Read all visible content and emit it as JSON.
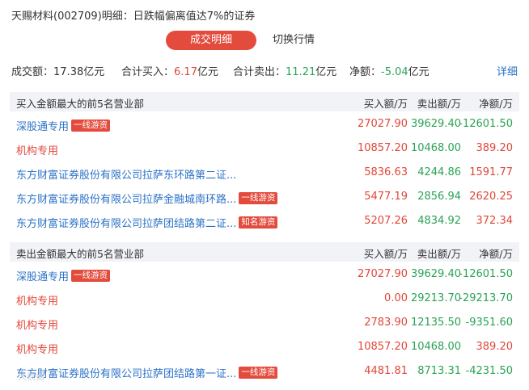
{
  "header": {
    "title": "天赐材料(002709)明细：日跌幅偏离值达7%的证券"
  },
  "tabs": {
    "active": "成交明细",
    "other": "切换行情"
  },
  "summary": {
    "turnover_label": "成交额：",
    "turnover_value": "17.38亿元",
    "buy_label": "合计买入：",
    "buy_value": "6.17",
    "buy_unit": "亿元",
    "sell_label": "合计卖出：",
    "sell_value": "11.21",
    "sell_unit": "亿元",
    "net_label": "净额：",
    "net_value": "-5.04",
    "net_unit": "亿元",
    "detail_link": "详细"
  },
  "columns": {
    "buy": "买入额/万",
    "sell": "卖出额/万",
    "net": "净额/万"
  },
  "buy_section": {
    "title": "买入金额最大的前5名营业部",
    "rows": [
      {
        "name": "深股通专用",
        "badge": "一线游资",
        "buy": "27027.90",
        "sell": "39629.40",
        "net": "-12601.50"
      },
      {
        "name": "机构专用",
        "badge": "",
        "buy": "10857.20",
        "sell": "10468.00",
        "net": "389.20"
      },
      {
        "name": "东方财富证券股份有限公司拉萨东环路第二证...",
        "badge": "",
        "buy": "5836.63",
        "sell": "4244.86",
        "net": "1591.77"
      },
      {
        "name": "东方财富证券股份有限公司拉萨金融城南环路...",
        "badge": "一线游资",
        "buy": "5477.19",
        "sell": "2856.94",
        "net": "2620.25"
      },
      {
        "name": "东方财富证券股份有限公司拉萨团结路第二证...",
        "badge": "知名游资",
        "buy": "5207.26",
        "sell": "4834.92",
        "net": "372.34"
      }
    ]
  },
  "sell_section": {
    "title": "卖出金额最大的前5名营业部",
    "rows": [
      {
        "name": "深股通专用",
        "badge": "一线游资",
        "buy": "27027.90",
        "sell": "39629.40",
        "net": "-12601.50"
      },
      {
        "name": "机构专用",
        "badge": "",
        "buy": "0.00",
        "sell": "29213.70",
        "net": "-29213.70"
      },
      {
        "name": "机构专用",
        "badge": "",
        "buy": "2783.90",
        "sell": "12135.50",
        "net": "-9351.60"
      },
      {
        "name": "机构专用",
        "badge": "",
        "buy": "10857.20",
        "sell": "10468.00",
        "net": "389.20"
      },
      {
        "name": "东方财富证券股份有限公司拉萨团结路第一证...",
        "badge": "一线游资",
        "buy": "4481.81",
        "sell": "8713.31",
        "net": "-4231.50"
      }
    ]
  },
  "watermark": "大数据"
}
